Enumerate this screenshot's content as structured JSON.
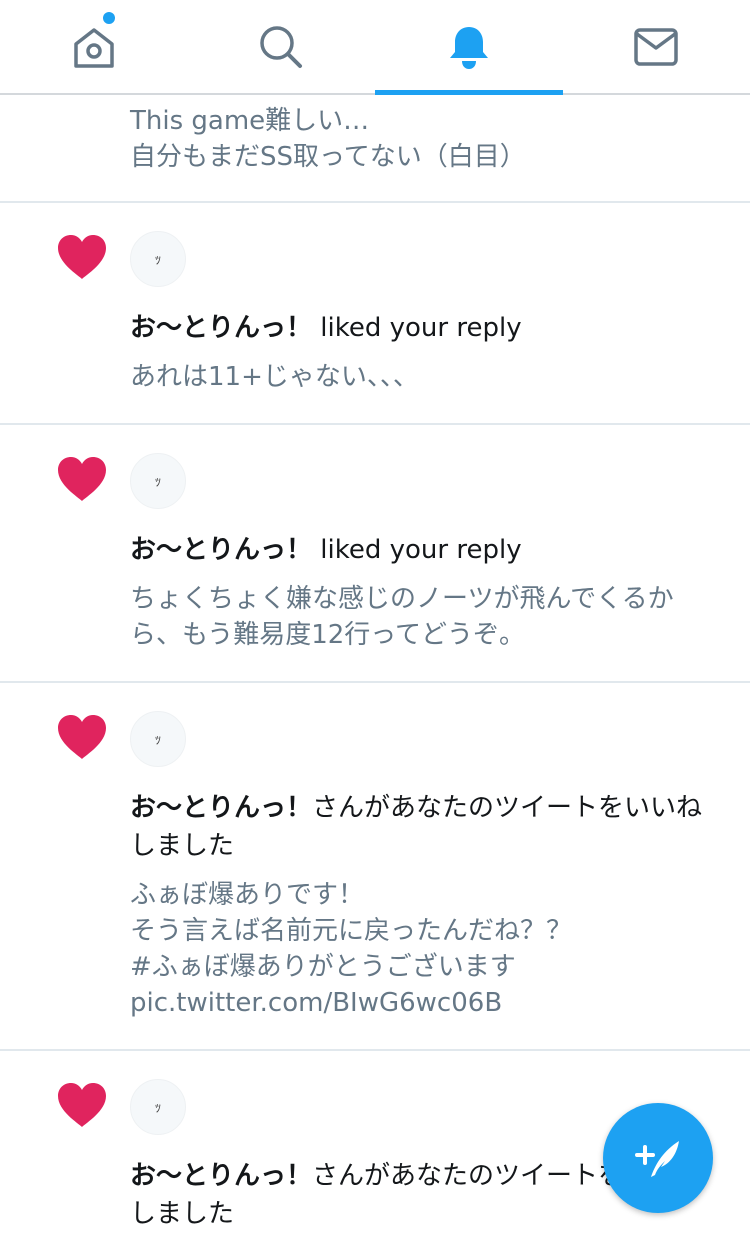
{
  "tabs": [
    {
      "name": "home",
      "icon": "home-icon",
      "active": false,
      "has_dot": true
    },
    {
      "name": "search",
      "icon": "search-icon",
      "active": false
    },
    {
      "name": "notifications",
      "icon": "bell-icon",
      "active": true
    },
    {
      "name": "messages",
      "icon": "mail-icon",
      "active": false
    }
  ],
  "colors": {
    "accent": "#1da1f2",
    "heart": "#e0245e",
    "muted_text": "#657786"
  },
  "feed": {
    "partial_text": "This game難しい…\n自分もまだSS取ってない（白目）",
    "items": [
      {
        "icon": "heart-icon",
        "avatar_text": "ｯ",
        "user": "お〜とりんっ！",
        "action": " liked your reply",
        "snippet": "あれは11+じゃない、、、"
      },
      {
        "icon": "heart-icon",
        "avatar_text": "ｯ",
        "user": "お〜とりんっ！",
        "action": " liked your reply",
        "snippet": "ちょくちょく嫌な感じのノーツが飛んでくるから、もう難易度12行ってどうぞ。"
      },
      {
        "icon": "heart-icon",
        "avatar_text": "ｯ",
        "user": "お〜とりんっ！",
        "action": "さんがあなたのツイートをいいねしました",
        "snippet": "ふぁぼ爆ありです！\nそう言えば名前元に戻ったんだね？？\n#ふぁぼ爆ありがとうございます\npic.twitter.com/BIwG6wc06B"
      },
      {
        "icon": "heart-icon",
        "avatar_text": "ｯ",
        "user": "お〜とりんっ！",
        "action": "さんがあなたのツイートをいいねしました",
        "snippet": ""
      }
    ]
  },
  "compose": {
    "icon": "compose-tweet-icon"
  }
}
